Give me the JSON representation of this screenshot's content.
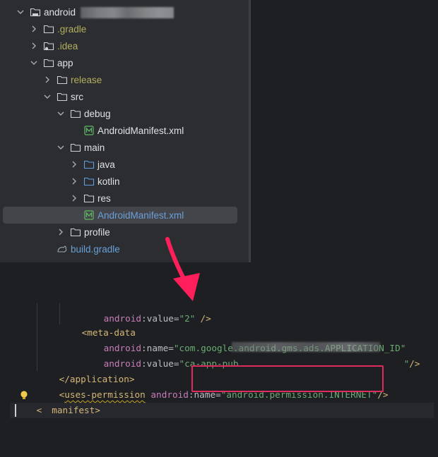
{
  "tree": {
    "items": [
      {
        "label": "android",
        "color": "white",
        "expanded": true,
        "icon": "module-folder-icon"
      },
      {
        "label": ".gradle",
        "color": "olive",
        "expanded": false,
        "icon": "folder-icon"
      },
      {
        "label": ".idea",
        "color": "olive",
        "expanded": false,
        "icon": "settings-folder-icon"
      },
      {
        "label": "app",
        "color": "white",
        "expanded": true,
        "icon": "folder-icon"
      },
      {
        "label": "release",
        "color": "olive",
        "expanded": false,
        "icon": "folder-icon"
      },
      {
        "label": "src",
        "color": "white",
        "expanded": true,
        "icon": "folder-icon"
      },
      {
        "label": "debug",
        "color": "white",
        "expanded": true,
        "icon": "folder-icon"
      },
      {
        "label": "AndroidManifest.xml",
        "color": "white",
        "icon": "manifest-file-icon"
      },
      {
        "label": "main",
        "color": "white",
        "expanded": true,
        "icon": "folder-icon"
      },
      {
        "label": "java",
        "color": "white",
        "expanded": false,
        "icon": "source-folder-icon"
      },
      {
        "label": "kotlin",
        "color": "white",
        "expanded": false,
        "icon": "source-folder-icon"
      },
      {
        "label": "res",
        "color": "white",
        "expanded": false,
        "icon": "folder-icon"
      },
      {
        "label": "AndroidManifest.xml",
        "color": "blue",
        "selected": true,
        "icon": "manifest-file-icon"
      },
      {
        "label": "profile",
        "color": "white",
        "expanded": false,
        "icon": "folder-icon"
      },
      {
        "label": "build.gradle",
        "color": "blue",
        "icon": "gradle-file-icon"
      }
    ]
  },
  "editor": {
    "lines": {
      "partial": {
        "ns": "android",
        "colon": ":",
        "attr": "value",
        "eq": "=",
        "str": "\"2\"",
        "end": "/>"
      },
      "meta_data_open": "<meta-data",
      "name_line": {
        "ns": "android",
        "attr": ":name",
        "eq": "=",
        "str": "\"com.google.android.gms.ads.APPLICATION_ID\""
      },
      "value_line": {
        "ns": "android",
        "attr": ":value",
        "eq": "=",
        "str_start": "\"ca-app-pub",
        "str_end": "\"",
        "end": "/>"
      },
      "application_close": "</application>",
      "uses_permission": {
        "open": "<",
        "tag": "uses-permission",
        "ns": "android",
        "attr": ":name",
        "eq": "=",
        "str": "\"android.permission.INTERNET\"",
        "end": "/>"
      },
      "manifest_close": {
        "open": "<",
        "rest": "manifest>"
      }
    }
  },
  "colors": {
    "highlight_box": "#e02b5e",
    "arrow": "#ff1f5a",
    "tag": "#d5b778",
    "namespace": "#c77dbb",
    "string": "#6aab73"
  }
}
